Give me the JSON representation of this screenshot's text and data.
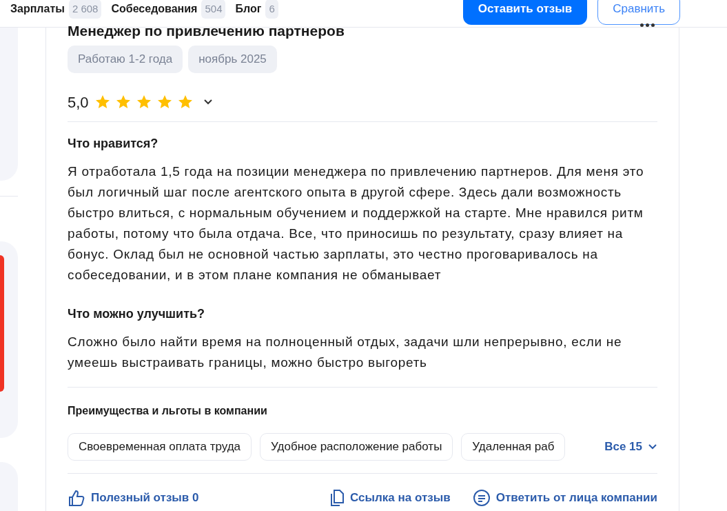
{
  "nav": {
    "links": [
      {
        "label": "Зарплаты",
        "count": "2 608"
      },
      {
        "label": "Собеседования",
        "count": "504"
      },
      {
        "label": "Блог",
        "count": "6"
      }
    ],
    "buttons": [
      {
        "label": "Оставить отзыв",
        "kind": "primary"
      },
      {
        "label": "Сравнить",
        "kind": "outline"
      }
    ]
  },
  "review": {
    "position": "Менеджер по привлечению партнеров",
    "tags": [
      "Работаю 1-2 года",
      "ноябрь 2025"
    ],
    "rating": "5,0",
    "stars": 5,
    "sections": [
      {
        "heading": "Что нравится?",
        "text": "Я отработала 1,5 года на позиции менеджера по привлечению партнеров. Для меня это был логичный шаг после агентского опыта в другой сфере. Здесь дали возможность быстро влиться, с нормальным обучением и поддержкой на старте. Мне нравился ритм работы, потому что была отдача. Все, что приносишь по результату, сразу влияет на бонус. Оклад был не основной частью зарплаты, это честно проговаривалось на собеседовании, и в этом плане компания не обманывает"
      },
      {
        "heading": "Что можно улучшить?",
        "text": "Сложно было найти время на полноценный отдых, задачи шли непрерывно, если не умеешь выстраивать границы, можно быстро выгореть"
      }
    ],
    "benefits": {
      "heading": "Преимущества и льготы в компании",
      "items": [
        "Своевременная оплата труда",
        "Удобное расположение работы",
        "Удаленная раб"
      ],
      "more": "Все 15"
    },
    "actions": [
      {
        "label": "Полезный отзыв 0",
        "kind": "like"
      },
      {
        "label": "Ссылка на отзыв",
        "kind": "copy"
      },
      {
        "label": "Ответить от лица компании",
        "kind": "reply"
      }
    ]
  }
}
